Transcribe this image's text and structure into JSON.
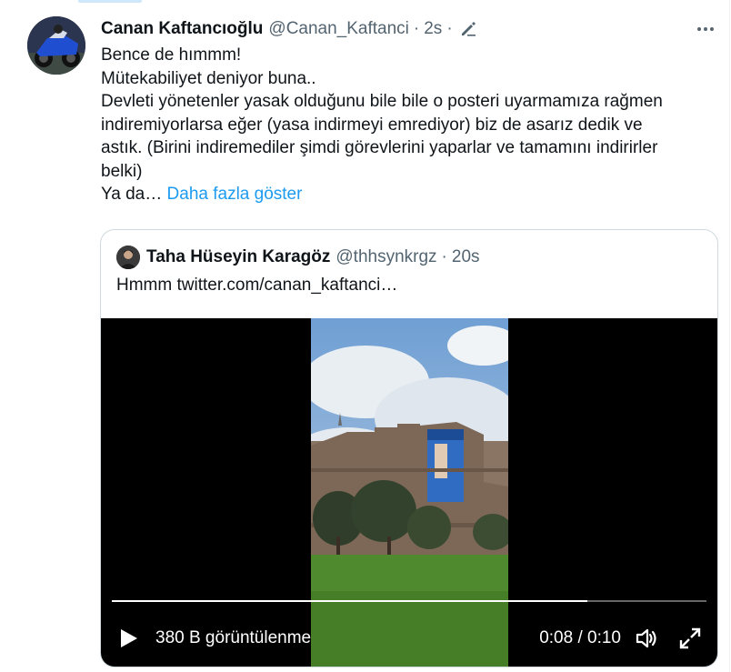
{
  "tweet": {
    "author_name": "Canan Kaftancıoğlu",
    "author_handle": "@Canan_Kaftanci",
    "separator": "·",
    "time": "2s",
    "lines": [
      "Bence de hımmm!",
      "Mütekabiliyet deniyor buna..",
      "Devleti yönetenler yasak olduğunu bile bile o posteri uyarmamıza rağmen",
      "indiremiyorlarsa eğer (yasa indirmeyi emrediyor) biz de asarız dedik ve",
      "astık. (Birini indiremediler şimdi görevlerini yaparlar ve tamamını indirirler",
      "belki)"
    ],
    "last_line_start": "Ya da…",
    "show_more": "Daha fazla göster",
    "icons": {
      "edit": "pencil-icon",
      "more": "more-horizontal-icon"
    }
  },
  "quoted": {
    "author_name": "Taha Hüseyin Karagöz",
    "author_handle": "@thhsynkrgz",
    "separator": "·",
    "time": "20s",
    "text": "Hmmm  twitter.com/canan_kaftanci…"
  },
  "video": {
    "progress": 0.8,
    "views": "380 B görüntülenme",
    "time_display": "0:08 / 0:10",
    "icons": {
      "play": "play-icon",
      "volume": "volume-icon",
      "fullscreen": "fullscreen-icon"
    }
  },
  "colors": {
    "text": "#0f1419",
    "secondary": "#536471",
    "link": "#1d9bf0",
    "border": "#cfd9de"
  }
}
